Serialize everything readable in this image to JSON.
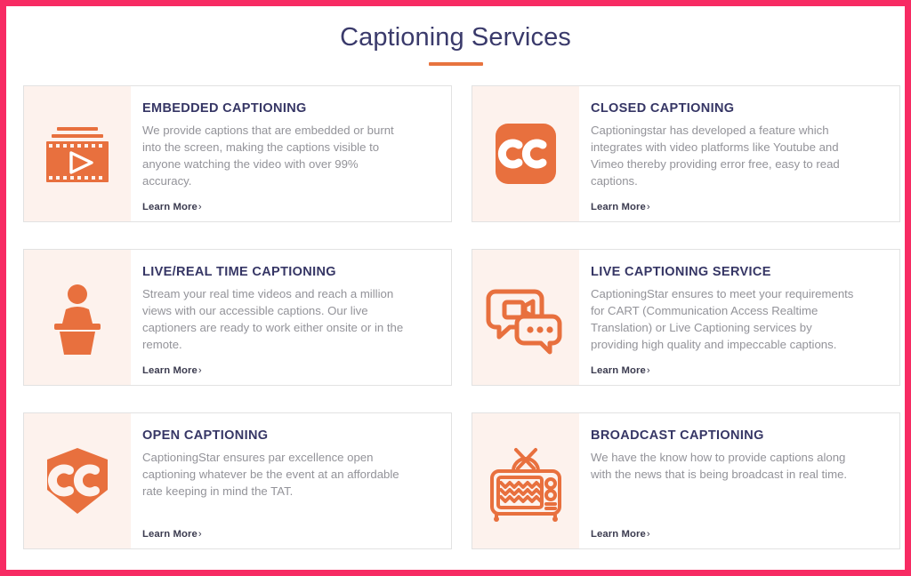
{
  "page": {
    "title": "Captioning Services",
    "accent_orange": "#e8733f",
    "border_pink": "#f72b63",
    "heading_navy": "#363665",
    "body_gray": "#939399",
    "icon_panel_bg": "#fdf2ed"
  },
  "cards": [
    {
      "icon": "film-strip-play-icon",
      "title": "EMBEDDED CAPTIONING",
      "description": "We provide captions that are embedded or burnt into the screen, making the captions visible to anyone watching the video with over 99% accuracy.",
      "link_label": "Learn More",
      "link_chevron": "›"
    },
    {
      "icon": "cc-rounded-square-icon",
      "title": "CLOSED CAPTIONING",
      "description": "Captioningstar has developed a feature which integrates with video platforms like Youtube and Vimeo thereby providing error free, easy to read captions.",
      "link_label": "Learn More",
      "link_chevron": "›"
    },
    {
      "icon": "speaker-podium-icon",
      "title": "LIVE/REAL TIME CAPTIONING",
      "description": "Stream your real time videos and reach a million views with our accessible captions. Our live captioners are ready to work either onsite or in the remote.",
      "link_label": "Learn More",
      "link_chevron": "›"
    },
    {
      "icon": "video-chat-bubbles-icon",
      "title": "LIVE CAPTIONING SERVICE",
      "description": "CaptioningStar ensures to meet your requirements for CART (Communication Access Realtime Translation) or Live Captioning services by providing high quality and impeccable captions.",
      "link_label": "Learn More",
      "link_chevron": "›"
    },
    {
      "icon": "cc-hexagon-shield-icon",
      "title": "OPEN CAPTIONING",
      "description": "CaptioningStar ensures par excellence open captioning whatever be the event at an affordable rate keeping in mind the TAT.",
      "link_label": "Learn More",
      "link_chevron": "›"
    },
    {
      "icon": "retro-tv-icon",
      "title": "BROADCAST CAPTIONING",
      "description": "We have the know how to provide captions along with the news that is being broadcast in real time.",
      "link_label": "Learn More",
      "link_chevron": "›"
    }
  ]
}
